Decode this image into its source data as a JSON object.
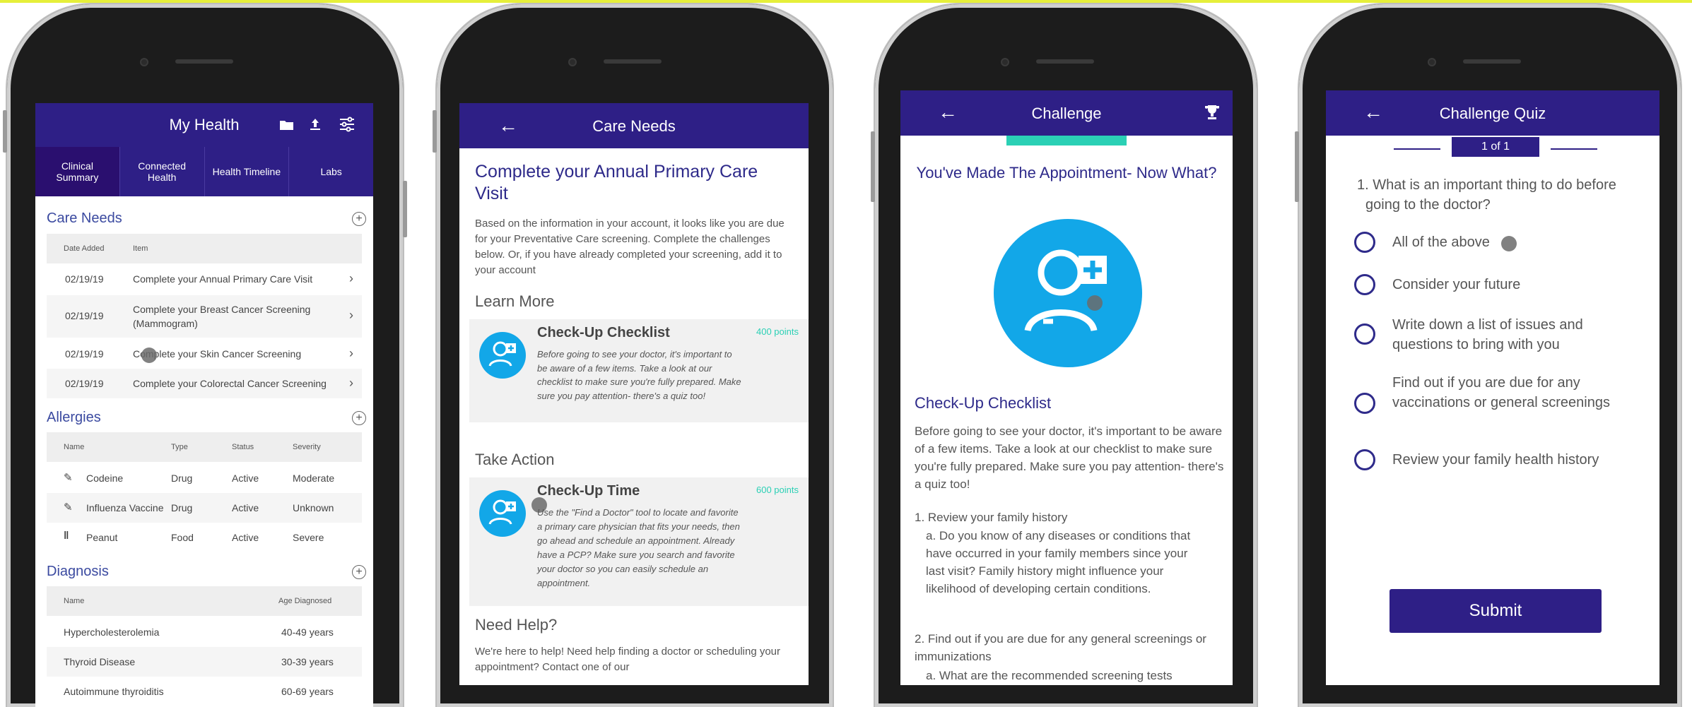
{
  "colors": {
    "brand": "#2e1f86",
    "accent": "#12a7e8",
    "points": "#2bd0b5"
  },
  "phone1": {
    "title": "My Health",
    "tabs": [
      "Clinical Summary",
      "Connected Health",
      "Health Timeline",
      "Labs"
    ],
    "care_needs": {
      "title": "Care Needs",
      "headers": [
        "Date Added",
        "Item"
      ],
      "rows": [
        {
          "date": "02/19/19",
          "item": "Complete your Annual Primary Care Visit"
        },
        {
          "date": "02/19/19",
          "item": "Complete your Breast Cancer Screening (Mammogram)"
        },
        {
          "date": "02/19/19",
          "item": "Complete your Skin Cancer Screening"
        },
        {
          "date": "02/19/19",
          "item": "Complete your Colorectal Cancer Screening"
        }
      ]
    },
    "allergies": {
      "title": "Allergies",
      "headers": [
        "Name",
        "Type",
        "Status",
        "Severity"
      ],
      "rows": [
        {
          "name": "Codeine",
          "type": "Drug",
          "status": "Active",
          "severity": "Moderate",
          "icon": "pill-icon"
        },
        {
          "name": "Influenza Vaccine",
          "type": "Drug",
          "status": "Active",
          "severity": "Unknown",
          "icon": "syringe-icon"
        },
        {
          "name": "Peanut",
          "type": "Food",
          "status": "Active",
          "severity": "Severe",
          "icon": "fork-knife-icon"
        }
      ]
    },
    "diagnosis": {
      "title": "Diagnosis",
      "headers": [
        "Name",
        "Age Diagnosed"
      ],
      "rows": [
        {
          "name": "Hypercholesterolemia",
          "age": "40-49 years"
        },
        {
          "name": "Thyroid Disease",
          "age": "30-39 years"
        },
        {
          "name": "Autoimmune thyroiditis",
          "age": "60-69 years"
        }
      ]
    }
  },
  "phone2": {
    "title": "Care Needs",
    "heading": "Complete your Annual Primary Care Visit",
    "intro": "Based on the information in your account, it looks like you are due for your Preventative Care screening. Complete the challenges below. Or, if you have already completed your screening, add it to your account",
    "learn_more": "Learn More",
    "card1": {
      "title": "Check-Up Checklist",
      "points": "400 points",
      "text": "Before going to see your doctor, it's important to be aware of a few items. Take a look at our checklist to make sure you're fully prepared. Make sure you pay attention- there's a quiz too!"
    },
    "take_action": "Take Action",
    "card2": {
      "title": "Check-Up Time",
      "points": "600 points",
      "text": "Use the \"Find a Doctor\" tool to locate and favorite a primary care physician that fits your needs, then go ahead and schedule an appointment. Already have a PCP? Make sure you search and favorite your doctor so you can easily schedule an appointment."
    },
    "need_help": "Need Help?",
    "help_text": "We're here to help! Need help finding a doctor or scheduling your appointment? Contact one of our"
  },
  "phone3": {
    "title": "Challenge",
    "heading": "You've Made The Appointment- Now What?",
    "section": "Check-Up Checklist",
    "para": "Before going to see your doctor, it's important to be aware of a few items. Take a look at our checklist to make sure you're fully prepared. Make sure you pay attention- there's a quiz too!",
    "item1": "1. Review your family history",
    "item1a": "a. Do you know of any diseases or conditions that have occurred in your family members since your last visit? Family history might influence your likelihood of developing certain conditions.",
    "item2": "2. Find out if you are due for any general screenings or immunizations",
    "item2a": "a. What are the recommended screening tests"
  },
  "phone4": {
    "title": "Challenge Quiz",
    "progress": "1 of 1",
    "question": "1.  What is an important thing to do before going to the doctor?",
    "options": [
      "All of the above",
      "Consider your future",
      "Write down a list of issues and questions to bring with you",
      "Find out if you are due for any vaccinations or general screenings",
      "Review your family health history"
    ],
    "submit": "Submit"
  }
}
